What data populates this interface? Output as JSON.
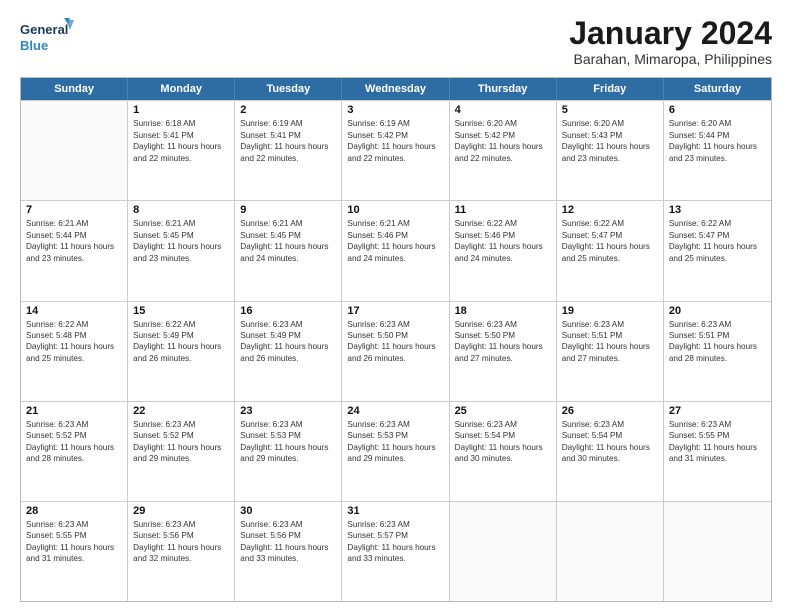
{
  "logo": {
    "line1": "General",
    "line2": "Blue"
  },
  "title": "January 2024",
  "subtitle": "Barahan, Mimaropa, Philippines",
  "header": {
    "days": [
      "Sunday",
      "Monday",
      "Tuesday",
      "Wednesday",
      "Thursday",
      "Friday",
      "Saturday"
    ]
  },
  "weeks": [
    [
      {
        "day": "",
        "empty": true
      },
      {
        "day": "1",
        "sunrise": "6:18 AM",
        "sunset": "5:41 PM",
        "daylight": "11 hours and 22 minutes."
      },
      {
        "day": "2",
        "sunrise": "6:19 AM",
        "sunset": "5:41 PM",
        "daylight": "11 hours and 22 minutes."
      },
      {
        "day": "3",
        "sunrise": "6:19 AM",
        "sunset": "5:42 PM",
        "daylight": "11 hours and 22 minutes."
      },
      {
        "day": "4",
        "sunrise": "6:20 AM",
        "sunset": "5:42 PM",
        "daylight": "11 hours and 22 minutes."
      },
      {
        "day": "5",
        "sunrise": "6:20 AM",
        "sunset": "5:43 PM",
        "daylight": "11 hours and 23 minutes."
      },
      {
        "day": "6",
        "sunrise": "6:20 AM",
        "sunset": "5:44 PM",
        "daylight": "11 hours and 23 minutes."
      }
    ],
    [
      {
        "day": "7",
        "sunrise": "6:21 AM",
        "sunset": "5:44 PM",
        "daylight": "11 hours and 23 minutes."
      },
      {
        "day": "8",
        "sunrise": "6:21 AM",
        "sunset": "5:45 PM",
        "daylight": "11 hours and 23 minutes."
      },
      {
        "day": "9",
        "sunrise": "6:21 AM",
        "sunset": "5:45 PM",
        "daylight": "11 hours and 24 minutes."
      },
      {
        "day": "10",
        "sunrise": "6:21 AM",
        "sunset": "5:46 PM",
        "daylight": "11 hours and 24 minutes."
      },
      {
        "day": "11",
        "sunrise": "6:22 AM",
        "sunset": "5:46 PM",
        "daylight": "11 hours and 24 minutes."
      },
      {
        "day": "12",
        "sunrise": "6:22 AM",
        "sunset": "5:47 PM",
        "daylight": "11 hours and 25 minutes."
      },
      {
        "day": "13",
        "sunrise": "6:22 AM",
        "sunset": "5:47 PM",
        "daylight": "11 hours and 25 minutes."
      }
    ],
    [
      {
        "day": "14",
        "sunrise": "6:22 AM",
        "sunset": "5:48 PM",
        "daylight": "11 hours and 25 minutes."
      },
      {
        "day": "15",
        "sunrise": "6:22 AM",
        "sunset": "5:49 PM",
        "daylight": "11 hours and 26 minutes."
      },
      {
        "day": "16",
        "sunrise": "6:23 AM",
        "sunset": "5:49 PM",
        "daylight": "11 hours and 26 minutes."
      },
      {
        "day": "17",
        "sunrise": "6:23 AM",
        "sunset": "5:50 PM",
        "daylight": "11 hours and 26 minutes."
      },
      {
        "day": "18",
        "sunrise": "6:23 AM",
        "sunset": "5:50 PM",
        "daylight": "11 hours and 27 minutes."
      },
      {
        "day": "19",
        "sunrise": "6:23 AM",
        "sunset": "5:51 PM",
        "daylight": "11 hours and 27 minutes."
      },
      {
        "day": "20",
        "sunrise": "6:23 AM",
        "sunset": "5:51 PM",
        "daylight": "11 hours and 28 minutes."
      }
    ],
    [
      {
        "day": "21",
        "sunrise": "6:23 AM",
        "sunset": "5:52 PM",
        "daylight": "11 hours and 28 minutes."
      },
      {
        "day": "22",
        "sunrise": "6:23 AM",
        "sunset": "5:52 PM",
        "daylight": "11 hours and 29 minutes."
      },
      {
        "day": "23",
        "sunrise": "6:23 AM",
        "sunset": "5:53 PM",
        "daylight": "11 hours and 29 minutes."
      },
      {
        "day": "24",
        "sunrise": "6:23 AM",
        "sunset": "5:53 PM",
        "daylight": "11 hours and 29 minutes."
      },
      {
        "day": "25",
        "sunrise": "6:23 AM",
        "sunset": "5:54 PM",
        "daylight": "11 hours and 30 minutes."
      },
      {
        "day": "26",
        "sunrise": "6:23 AM",
        "sunset": "5:54 PM",
        "daylight": "11 hours and 30 minutes."
      },
      {
        "day": "27",
        "sunrise": "6:23 AM",
        "sunset": "5:55 PM",
        "daylight": "11 hours and 31 minutes."
      }
    ],
    [
      {
        "day": "28",
        "sunrise": "6:23 AM",
        "sunset": "5:55 PM",
        "daylight": "11 hours and 31 minutes."
      },
      {
        "day": "29",
        "sunrise": "6:23 AM",
        "sunset": "5:56 PM",
        "daylight": "11 hours and 32 minutes."
      },
      {
        "day": "30",
        "sunrise": "6:23 AM",
        "sunset": "5:56 PM",
        "daylight": "11 hours and 33 minutes."
      },
      {
        "day": "31",
        "sunrise": "6:23 AM",
        "sunset": "5:57 PM",
        "daylight": "11 hours and 33 minutes."
      },
      {
        "day": "",
        "empty": true
      },
      {
        "day": "",
        "empty": true
      },
      {
        "day": "",
        "empty": true
      }
    ]
  ]
}
